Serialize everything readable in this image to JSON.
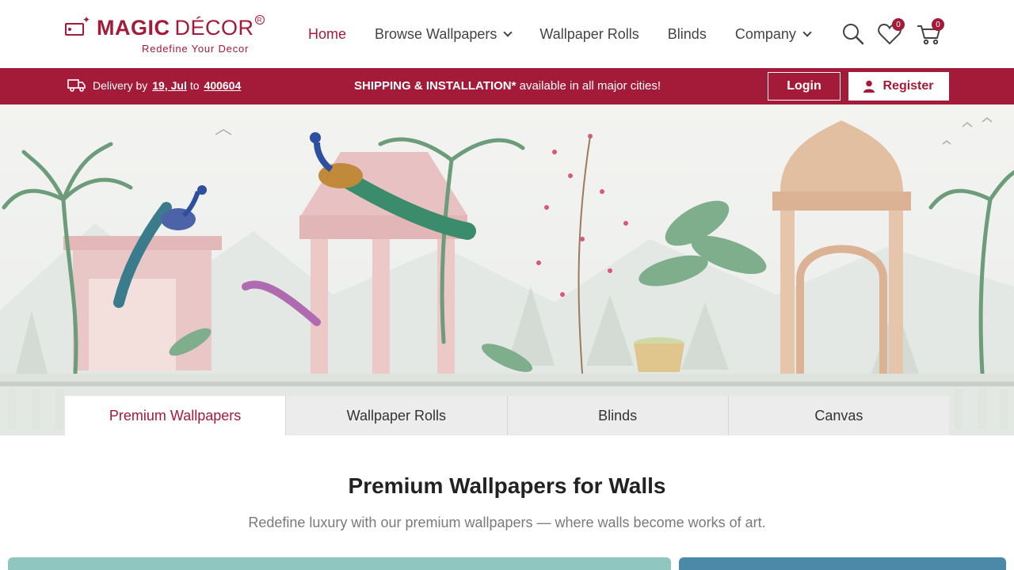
{
  "header": {
    "logo": {
      "brand_bold": "MAGIC",
      "brand_light": "DÉCOR",
      "tagline": "Redefine Your Decor"
    },
    "nav": [
      {
        "label": "Home",
        "active": true,
        "dropdown": false
      },
      {
        "label": "Browse Wallpapers",
        "active": false,
        "dropdown": true
      },
      {
        "label": "Wallpaper Rolls",
        "active": false,
        "dropdown": false
      },
      {
        "label": "Blinds",
        "active": false,
        "dropdown": false
      },
      {
        "label": "Company",
        "active": false,
        "dropdown": true
      }
    ],
    "wishlist_count": "0",
    "cart_count": "0"
  },
  "topbar": {
    "delivery_prefix": "Delivery by",
    "delivery_date": "19, Jul",
    "delivery_to": "to",
    "pincode": "400604",
    "shipping_bold": "SHIPPING & INSTALLATION*",
    "shipping_rest": " available in all major cities!",
    "login_label": "Login",
    "register_label": "Register"
  },
  "tabs": [
    {
      "label": "Premium Wallpapers",
      "active": true
    },
    {
      "label": "Wallpaper Rolls",
      "active": false
    },
    {
      "label": "Blinds",
      "active": false
    },
    {
      "label": "Canvas",
      "active": false
    }
  ],
  "section": {
    "title": "Premium Wallpapers for Walls",
    "subtitle": "Redefine luxury with our premium wallpapers — where walls become works of art."
  },
  "colors": {
    "brand": "#a31b38",
    "tab_bg": "#ececec"
  },
  "icons": [
    "search-icon",
    "heart-icon",
    "cart-icon",
    "truck-icon",
    "user-icon",
    "chevron-down-icon"
  ]
}
